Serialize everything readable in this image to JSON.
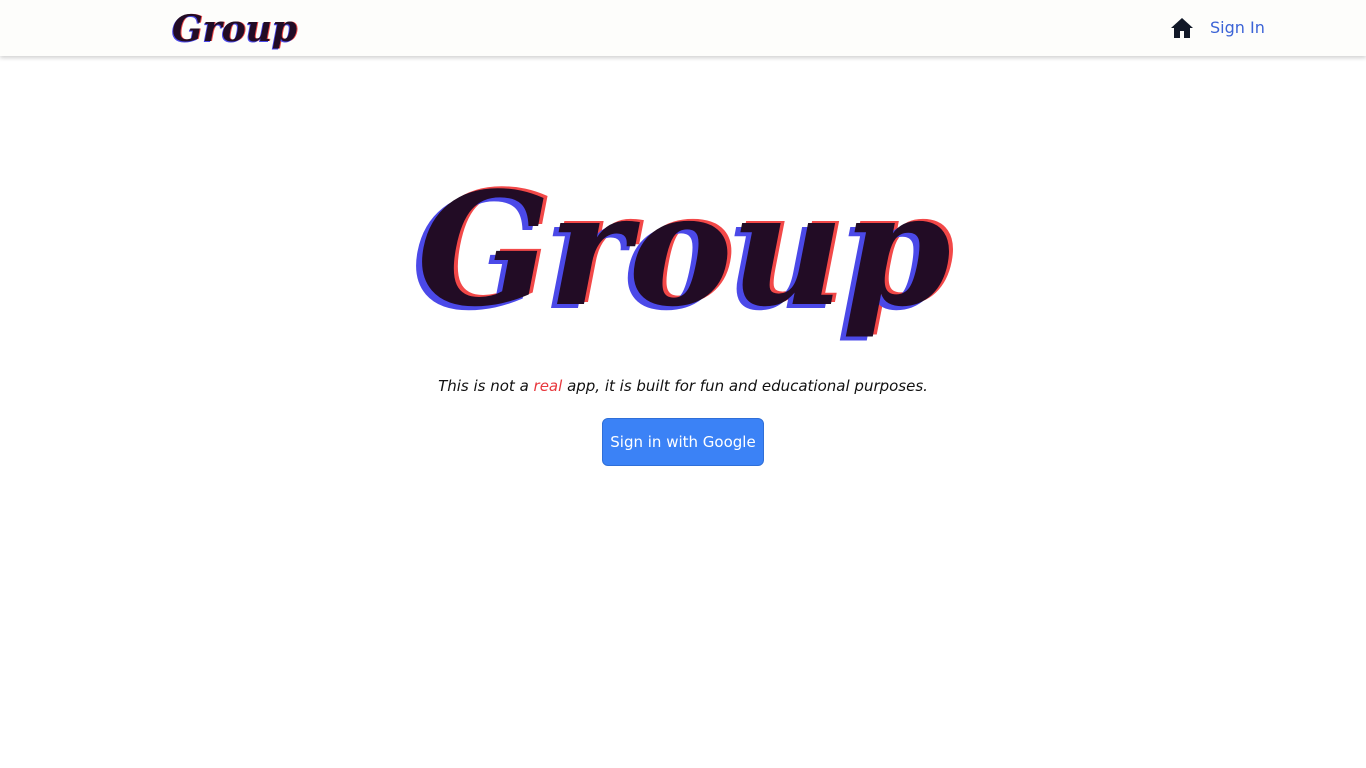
{
  "navbar": {
    "brand": "Group",
    "home_icon": "home-icon",
    "signin_label": "Sign In"
  },
  "hero": {
    "title": "Group",
    "tagline_before": "This is not a ",
    "tagline_accent": "real",
    "tagline_after": " app, it is built for fun and educational purposes.",
    "signin_google_label": "Sign in with Google"
  },
  "colors": {
    "title_fill": "#220c25",
    "title_shadow_blue": "#4b49e8",
    "title_shadow_red": "#f24848",
    "link": "#3b63d6",
    "accent_red": "#e8383d",
    "button_bg": "#3b82f6"
  }
}
